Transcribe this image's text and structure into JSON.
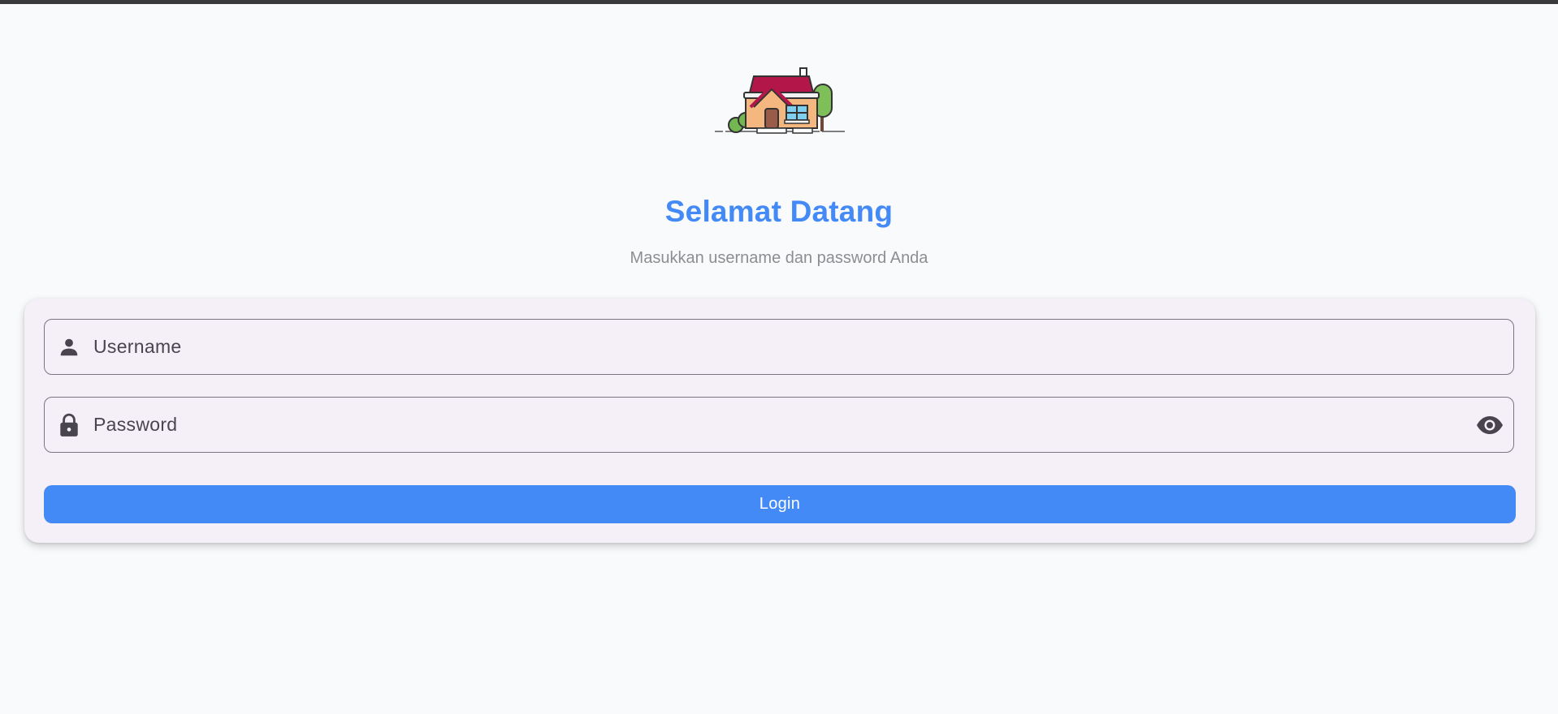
{
  "header": {
    "title": "Selamat Datang",
    "subtitle": "Masukkan username dan password Anda"
  },
  "logo": {
    "icon": "house-icon"
  },
  "form": {
    "username": {
      "placeholder": "Username",
      "value": "",
      "icon": "person-icon"
    },
    "password": {
      "placeholder": "Password",
      "value": "",
      "icon": "lock-icon",
      "toggle_icon": "eye-icon"
    },
    "login_label": "Login"
  },
  "colors": {
    "accent": "#448af7",
    "background": "#f9fafc",
    "card": "#f5f0f7",
    "subtitle": "#8d8d92",
    "icon": "#49454f"
  }
}
